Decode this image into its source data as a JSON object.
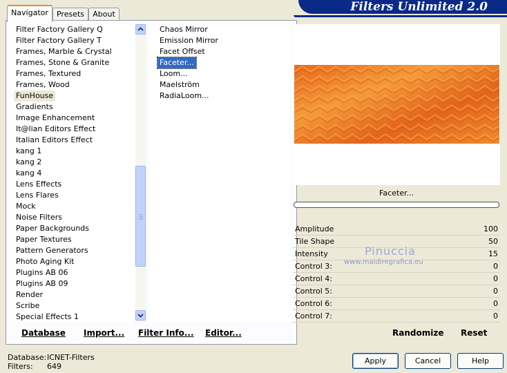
{
  "banner": {
    "title": "Filters Unlimited 2.0"
  },
  "tabs": [
    {
      "label": "Navigator",
      "active": true
    },
    {
      "label": "Presets",
      "active": false
    },
    {
      "label": "About",
      "active": false
    }
  ],
  "categories": {
    "items": [
      "Filter Factory Gallery Q",
      "Filter Factory Gallery T",
      "Frames, Marble & Crystal",
      "Frames, Stone & Granite",
      "Frames, Textured",
      "Frames, Wood",
      "FunHouse",
      "Gradients",
      "Image Enhancement",
      "It@lian Editors Effect",
      "Italian Editors Effect",
      "kang 1",
      "kang 2",
      "kang 4",
      "Lens Effects",
      "Lens Flares",
      "Mock",
      "Noise Filters",
      "Paper Backgrounds",
      "Paper Textures",
      "Pattern Generators",
      "Photo Aging Kit",
      "Plugins AB 06",
      "Plugins AB 09",
      "Render",
      "Scribe",
      "Special Effects 1"
    ],
    "selected": "FunHouse"
  },
  "filters": {
    "items": [
      "Chaos Mirror",
      "Emission Mirror",
      "Facet Offset",
      "Faceter...",
      "Loom...",
      "Maelström",
      "RadiaLoom..."
    ],
    "selected": "Faceter..."
  },
  "bottom_links": {
    "database": "Database",
    "import": "Import...",
    "filter_info": "Filter Info...",
    "editor": "Editor..."
  },
  "preview": {
    "filter_name": "Faceter..."
  },
  "controls": [
    {
      "label": "Amplitude",
      "value": "100"
    },
    {
      "label": "Tile Shape",
      "value": "50"
    },
    {
      "label": "Intensity",
      "value": "15"
    },
    {
      "label": "Control 3:",
      "value": "0"
    },
    {
      "label": "Control 4:",
      "value": "0"
    },
    {
      "label": "Control 5:",
      "value": "0"
    },
    {
      "label": "Control 6:",
      "value": "0"
    },
    {
      "label": "Control 7:",
      "value": "0"
    }
  ],
  "watermark": {
    "name": "Pinuccia",
    "site": "www.maidiregrafica.eu"
  },
  "actions": {
    "randomize": "Randomize",
    "reset": "Reset"
  },
  "status": {
    "database_label": "Database:",
    "database_value": "ICNET-Filters",
    "filters_label": "Filters:",
    "filters_value": "649"
  },
  "buttons": {
    "apply": "Apply",
    "cancel": "Cancel",
    "help": "Help"
  },
  "colors": {
    "banner": "#0a2a88",
    "selection": "#316ac5",
    "tab_accent": "#e68b2c",
    "pattern_dark": "#e0601a",
    "pattern_light": "#f7a040"
  }
}
